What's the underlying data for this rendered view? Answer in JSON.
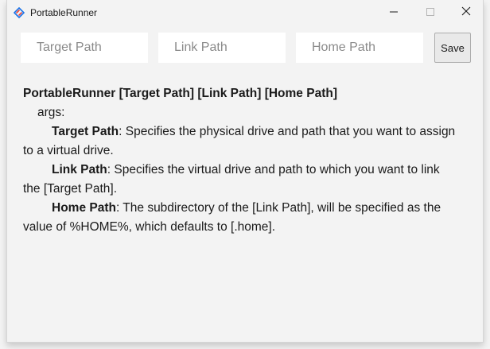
{
  "window": {
    "title": "PortableRunner",
    "accent": "#1a73e8"
  },
  "inputs": {
    "target_placeholder": "Target Path",
    "link_placeholder": "Link Path",
    "home_placeholder": "Home Path",
    "target_value": "",
    "link_value": "",
    "home_value": "",
    "save_label": "Save"
  },
  "help": {
    "usage": "PortableRunner [Target Path] [Link Path] [Home Path]",
    "args_label": "args:",
    "target": {
      "name": "Target Path",
      "desc_line1": ": Specifies the physical drive and path that you want to assign",
      "desc_line2": "to a virtual drive."
    },
    "link": {
      "name": "Link Path",
      "desc_line1": ": Specifies the virtual drive and path to which you want to link",
      "desc_line2": "the [Target Path]."
    },
    "home": {
      "name": "Home Path",
      "desc_line1": ": The subdirectory of the [Link Path], will be specified as the",
      "desc_line2": "value of %HOME%, which defaults to [.home]."
    }
  },
  "icons": {
    "app": "app-logo-icon",
    "minimize": "minimize-icon",
    "maximize": "maximize-icon",
    "close": "close-icon"
  }
}
